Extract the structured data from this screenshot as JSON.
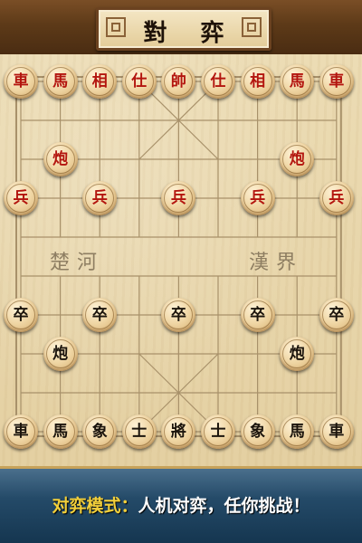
{
  "title": "對 弈",
  "river": {
    "left": "楚河",
    "right": "漢界"
  },
  "caption": {
    "mode": "对弈模式：",
    "desc": "人机对弈，任你挑战！"
  },
  "colors": {
    "red_piece_text": "#b3150e",
    "black_piece_text": "#1b140c",
    "caption_mode": "#f2cf3a",
    "caption_desc": "#ffffff"
  },
  "pieces": [
    {
      "side": "red",
      "char": "車",
      "name": "red-chariot-left",
      "col": 0,
      "row": 0
    },
    {
      "side": "red",
      "char": "馬",
      "name": "red-horse-left",
      "col": 1,
      "row": 0
    },
    {
      "side": "red",
      "char": "相",
      "name": "red-minister-left",
      "col": 2,
      "row": 0
    },
    {
      "side": "red",
      "char": "仕",
      "name": "red-advisor-left",
      "col": 3,
      "row": 0
    },
    {
      "side": "red",
      "char": "帥",
      "name": "red-general",
      "col": 4,
      "row": 0
    },
    {
      "side": "red",
      "char": "仕",
      "name": "red-advisor-right",
      "col": 5,
      "row": 0
    },
    {
      "side": "red",
      "char": "相",
      "name": "red-minister-right",
      "col": 6,
      "row": 0
    },
    {
      "side": "red",
      "char": "馬",
      "name": "red-horse-right",
      "col": 7,
      "row": 0
    },
    {
      "side": "red",
      "char": "車",
      "name": "red-chariot-right",
      "col": 8,
      "row": 0
    },
    {
      "side": "red",
      "char": "炮",
      "name": "red-cannon-left",
      "col": 1,
      "row": 2
    },
    {
      "side": "red",
      "char": "炮",
      "name": "red-cannon-right",
      "col": 7,
      "row": 2
    },
    {
      "side": "red",
      "char": "兵",
      "name": "red-soldier-1",
      "col": 0,
      "row": 3
    },
    {
      "side": "red",
      "char": "兵",
      "name": "red-soldier-2",
      "col": 2,
      "row": 3
    },
    {
      "side": "red",
      "char": "兵",
      "name": "red-soldier-3",
      "col": 4,
      "row": 3
    },
    {
      "side": "red",
      "char": "兵",
      "name": "red-soldier-4",
      "col": 6,
      "row": 3
    },
    {
      "side": "red",
      "char": "兵",
      "name": "red-soldier-5",
      "col": 8,
      "row": 3
    },
    {
      "side": "black",
      "char": "卒",
      "name": "black-soldier-1",
      "col": 0,
      "row": 6
    },
    {
      "side": "black",
      "char": "卒",
      "name": "black-soldier-2",
      "col": 2,
      "row": 6
    },
    {
      "side": "black",
      "char": "卒",
      "name": "black-soldier-3",
      "col": 4,
      "row": 6
    },
    {
      "side": "black",
      "char": "卒",
      "name": "black-soldier-4",
      "col": 6,
      "row": 6
    },
    {
      "side": "black",
      "char": "卒",
      "name": "black-soldier-5",
      "col": 8,
      "row": 6
    },
    {
      "side": "black",
      "char": "炮",
      "name": "black-cannon-left",
      "col": 1,
      "row": 7
    },
    {
      "side": "black",
      "char": "炮",
      "name": "black-cannon-right",
      "col": 7,
      "row": 7
    },
    {
      "side": "black",
      "char": "車",
      "name": "black-chariot-left",
      "col": 0,
      "row": 9
    },
    {
      "side": "black",
      "char": "馬",
      "name": "black-horse-left",
      "col": 1,
      "row": 9
    },
    {
      "side": "black",
      "char": "象",
      "name": "black-elephant-left",
      "col": 2,
      "row": 9
    },
    {
      "side": "black",
      "char": "士",
      "name": "black-advisor-left",
      "col": 3,
      "row": 9
    },
    {
      "side": "black",
      "char": "將",
      "name": "black-general",
      "col": 4,
      "row": 9
    },
    {
      "side": "black",
      "char": "士",
      "name": "black-advisor-right",
      "col": 5,
      "row": 9
    },
    {
      "side": "black",
      "char": "象",
      "name": "black-elephant-right",
      "col": 6,
      "row": 9
    },
    {
      "side": "black",
      "char": "馬",
      "name": "black-horse-right",
      "col": 7,
      "row": 9
    },
    {
      "side": "black",
      "char": "車",
      "name": "black-chariot-right",
      "col": 8,
      "row": 9
    }
  ]
}
